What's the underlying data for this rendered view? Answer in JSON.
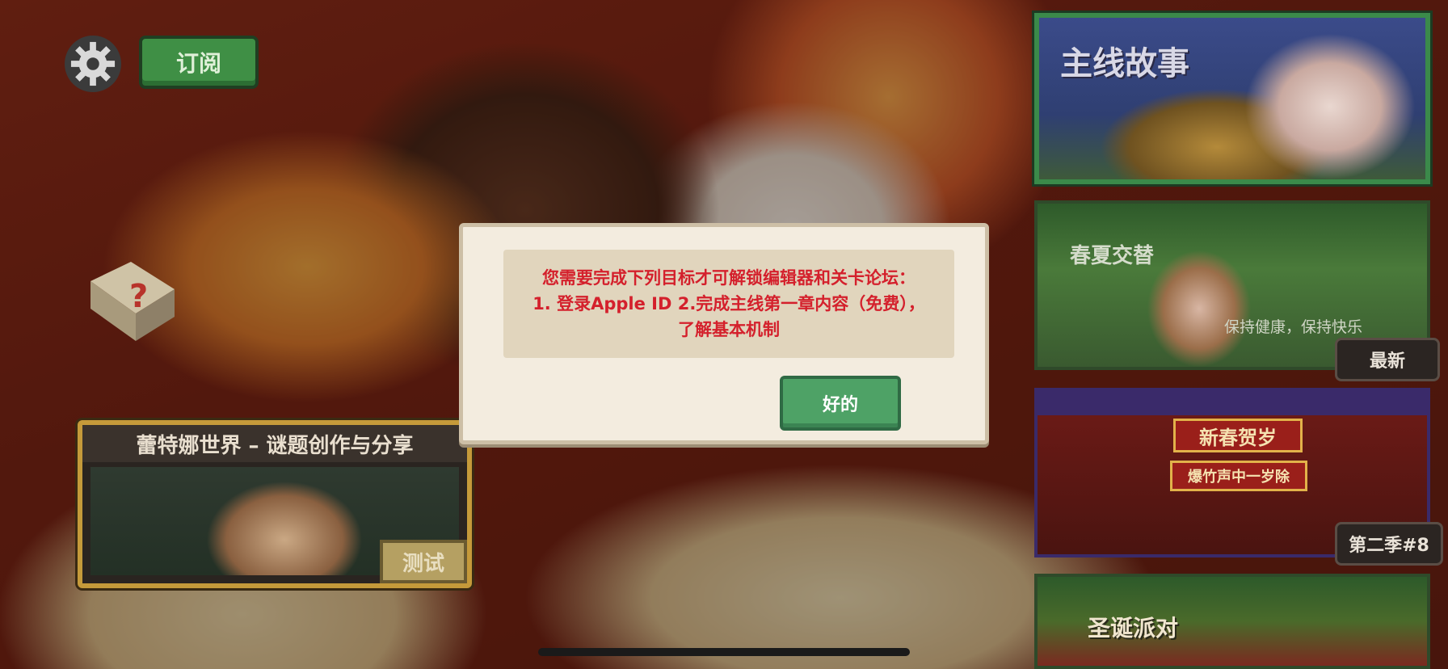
{
  "top_bar": {
    "settings_icon": "gear-icon",
    "subscribe_label": "订阅"
  },
  "help_icon": "question-book-icon",
  "world_card": {
    "title": "蕾特娜世界 – 谜题创作与分享",
    "button_label": "测试"
  },
  "right_cards": {
    "main_story": {
      "title": "主线故事"
    },
    "spring_summer": {
      "title": "春夏交替",
      "subtitle": "保持健康，保持快乐",
      "badge": "最新"
    },
    "new_year": {
      "sign1": "新春贺岁",
      "sign2": "爆竹声中一岁除",
      "badge": "第二季#8"
    },
    "christmas": {
      "title": "圣诞派对"
    }
  },
  "dialog": {
    "message": "您需要完成下列目标才可解锁编辑器和关卡论坛：\n1. 登录Apple ID 2.完成主线第一章内容（免费），\n了解基本机制",
    "ok_label": "好的"
  },
  "colors": {
    "modal_bg": "#f3ecdf",
    "message_text": "#d4202c",
    "ok_button": "#4ea266",
    "subscribe_button": "#3f8f45"
  }
}
